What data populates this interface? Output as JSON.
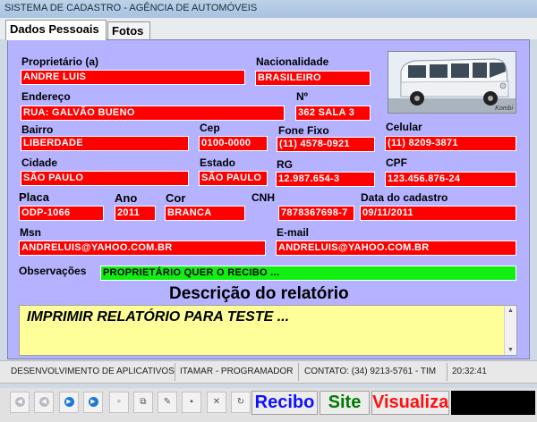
{
  "window": {
    "title": "SISTEMA DE CADASTRO - AGÊNCIA DE AUTOMÓVEIS"
  },
  "tabs": [
    {
      "label": "Dados Pessoais",
      "active": true
    },
    {
      "label": "Fotos",
      "active": false
    }
  ],
  "form": {
    "proprietario": {
      "label": "Proprietário (a)",
      "value": "ANDRE LUIS"
    },
    "nacionalidade": {
      "label": "Nacionalidade",
      "value": "BRASILEIRO"
    },
    "endereco": {
      "label": "Endereço",
      "value": "RUA: GALVÃO BUENO"
    },
    "numero": {
      "label": "Nº",
      "value": "362 SALA 3"
    },
    "bairro": {
      "label": "Bairro",
      "value": "LIBERDADE"
    },
    "cep": {
      "label": "Cep",
      "value": "0100-0000"
    },
    "fone_fixo": {
      "label": "Fone Fixo",
      "value": "(11) 4578-0921"
    },
    "celular": {
      "label": "Celular",
      "value": "(11) 8209-3871"
    },
    "cidade": {
      "label": "Cidade",
      "value": "SÃO PAULO"
    },
    "estado": {
      "label": "Estado",
      "value": "SÃO PAULO"
    },
    "rg": {
      "label": "RG",
      "value": "12.987.654-3"
    },
    "cpf": {
      "label": "CPF",
      "value": "123.456.876-24"
    },
    "placa": {
      "label": "Placa",
      "value": "ODP-1066"
    },
    "ano": {
      "label": "Ano",
      "value": "2011"
    },
    "cor": {
      "label": "Cor",
      "value": "BRANCA"
    },
    "cnh": {
      "label": "CNH",
      "value": "7878367698-7"
    },
    "data_cadastro": {
      "label": "Data do cadastro",
      "value": "09/11/2011"
    },
    "msn": {
      "label": "Msn",
      "value": "ANDRELUIS@YAHOO.COM.BR"
    },
    "email": {
      "label": "E-mail",
      "value": "ANDRELUIS@YAHOO.COM.BR"
    },
    "observacoes": {
      "label": "Observações",
      "value": "PROPRIETÁRIO QUER O RECIBO ..."
    }
  },
  "photo": {
    "caption": "Kombi"
  },
  "relatorio": {
    "title": "Descrição do relatório",
    "text": "IMPRIMIR RELATÓRIO PARA TESTE ..."
  },
  "status": {
    "desenvolvimento": "DESENVOLVIMENTO DE APLICATIVOS",
    "programador": "ITAMAR - PROGRAMADOR",
    "contato": "CONTATO: (34) 9213-5761 - TIM",
    "hora": "20:32:41"
  },
  "navigator": {
    "icons": [
      "first-record-icon",
      "prior-record-icon",
      "next-record-icon",
      "last-record-icon",
      "insert-record-icon",
      "delete-record-icon",
      "edit-record-icon",
      "post-record-icon",
      "cancel-record-icon",
      "refresh-record-icon"
    ]
  },
  "buttons": {
    "recibo": {
      "label": "Recibo",
      "color": "#1010ff"
    },
    "site": {
      "label": "Site",
      "color": "#007a00"
    },
    "visualizar": {
      "label": "Visualizar",
      "color": "#ff1010"
    }
  }
}
